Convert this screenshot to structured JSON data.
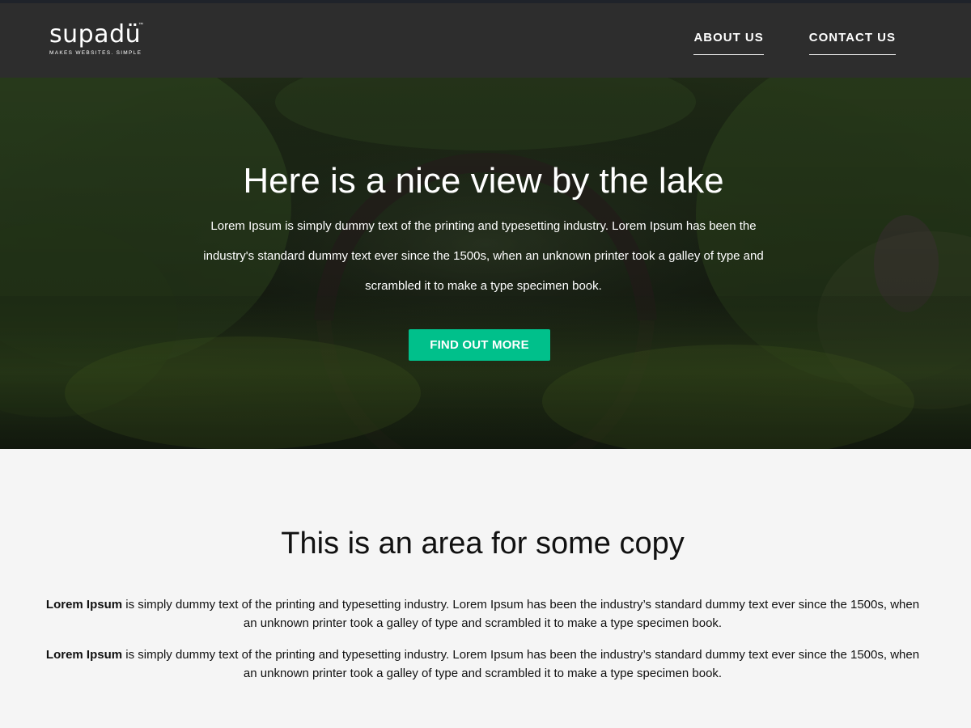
{
  "brand": {
    "name": "supadü",
    "trademark": "™",
    "tagline": "MAKES WEBSITES. SIMPLE"
  },
  "nav": {
    "items": [
      {
        "label": "ABOUT US"
      },
      {
        "label": "CONTACT US"
      }
    ]
  },
  "hero": {
    "title": "Here is a nice view by the lake",
    "text": "Lorem Ipsum is simply dummy text of the printing and typesetting industry. Lorem Ipsum has been the industry's standard dummy text ever since the 1500s, when an unknown printer took a galley of type and scrambled it to make a type specimen book.",
    "button_label": "FIND OUT MORE"
  },
  "copy": {
    "title": "This is an area for some copy",
    "paragraphs": [
      {
        "lead": "Lorem Ipsum",
        "text": " is simply dummy text of the printing and typesetting industry. Lorem Ipsum has been the industry’s standard dummy text ever since the 1500s, when an unknown printer took a galley of type and scrambled it to make a type specimen book."
      },
      {
        "lead": "Lorem Ipsum",
        "text": " is simply dummy text of the printing and typesetting industry. Lorem Ipsum has been the industry’s standard dummy text ever since the 1500s, when an unknown printer took a galley of type and scrambled it to make a type specimen book."
      }
    ]
  },
  "colors": {
    "header_bg": "#2d2d2d",
    "accent": "#00c08b",
    "page_bg": "#f5f5f5"
  }
}
